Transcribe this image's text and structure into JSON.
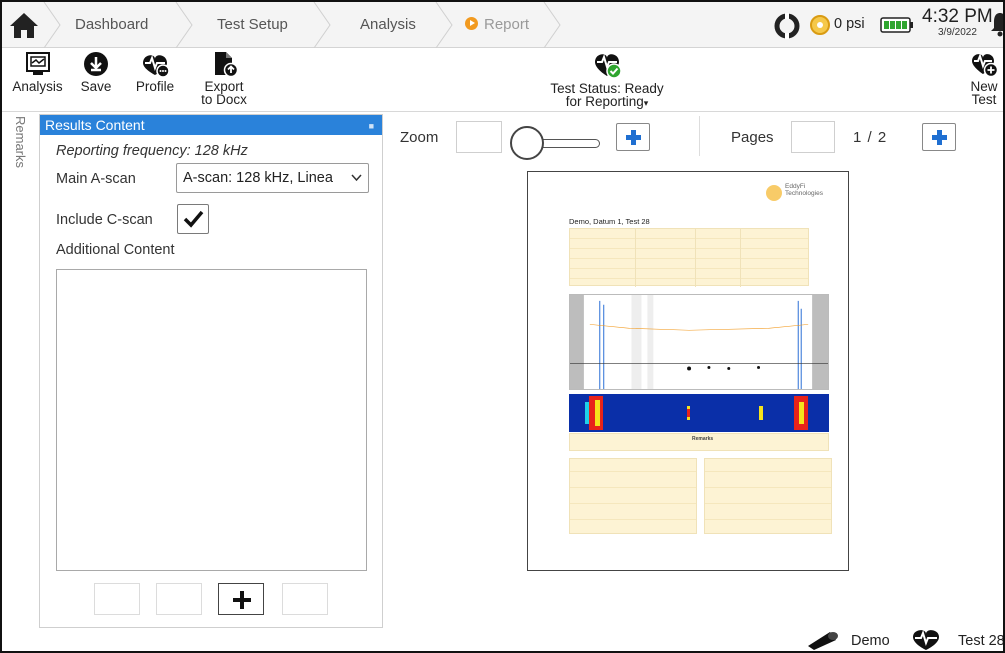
{
  "nav": {
    "crumbs": [
      "Dashboard",
      "Test Setup",
      "Analysis",
      "Report"
    ],
    "active": "Report"
  },
  "status": {
    "pressure": "0 psi",
    "time": "4:32 PM",
    "date": "3/9/2022"
  },
  "toolbar": {
    "analysis": "Analysis",
    "save": "Save",
    "profile": "Profile",
    "export_line1": "Export",
    "export_line2": "to Docx",
    "status_line1": "Test Status: Ready",
    "status_line2": "for Reporting",
    "new_line1": "New",
    "new_line2": "Test"
  },
  "sidebar": {
    "remarks_tab": "Remarks"
  },
  "results": {
    "title": "Results Content",
    "frequency": "Reporting frequency: 128 kHz",
    "main_ascan_label": "Main A-scan",
    "main_ascan_value": "A-scan: 128 kHz, Linea",
    "include_cscan_label": "Include C-scan",
    "include_cscan_checked": true,
    "additional_label": "Additional Content"
  },
  "viewer": {
    "zoom_label": "Zoom",
    "pages_label": "Pages",
    "current_page": "1",
    "page_sep": "/",
    "total_pages": "2"
  },
  "preview": {
    "title": "Demo, Datum 1, Test 28",
    "logo_line1": "EddyFi",
    "logo_line2": "Technologies",
    "remarks_heading": "Remarks"
  },
  "footer": {
    "project": "Demo",
    "test": "Test 28"
  },
  "colors": {
    "accent_blue": "#2a82da",
    "report_orange": "#f29a1f",
    "battery_green": "#2fa52f"
  }
}
